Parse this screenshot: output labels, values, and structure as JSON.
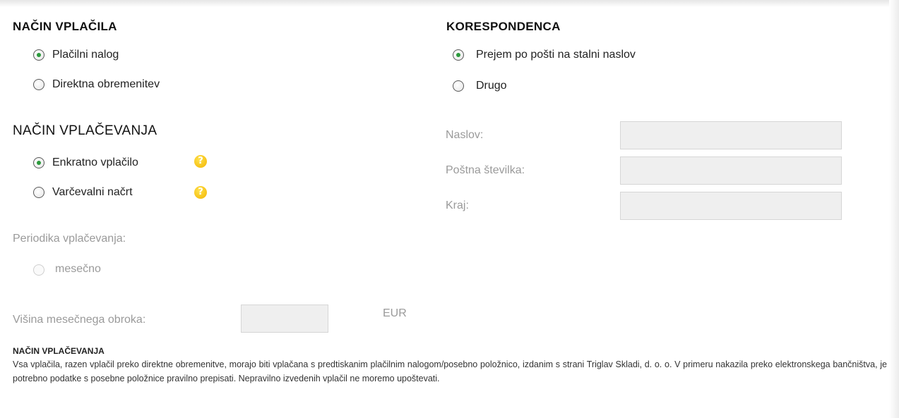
{
  "payment_method": {
    "heading": "NAČIN VPLAČILA",
    "options": [
      {
        "label": "Plačilni nalog",
        "selected": true
      },
      {
        "label": "Direktna obremenitev",
        "selected": false
      }
    ]
  },
  "correspondence": {
    "heading": "KORESPONDENCA",
    "options": [
      {
        "label": "Prejem po pošti na stalni naslov",
        "selected": true
      },
      {
        "label": "Drugo",
        "selected": false
      }
    ],
    "fields": {
      "address_label": "Naslov:",
      "postal_label": "Poštna številka:",
      "city_label": "Kraj:"
    }
  },
  "payment_mode": {
    "heading": "NAČIN VPLAČEVANJA",
    "options": [
      {
        "label": "Enkratno vplačilo",
        "selected": true
      },
      {
        "label": "Varčevalni načrt",
        "selected": false
      }
    ],
    "help_glyph": "?",
    "periodicity_label": "Periodika vplačevanja:",
    "periodicity_option": "mesečno",
    "installment_label": "Višina mesečnega obroka:",
    "currency": "EUR"
  },
  "note": {
    "heading": "NAČIN VPLAČEVANJA",
    "text": "Vsa vplačila, razen vplačil preko direktne obremenitve, morajo biti vplačana s predtiskanim plačilnim nalogom/posebno položnico, izdanim s strani Triglav Skladi, d. o. o. V primeru nakazila preko elektronskega bančništva, je potrebno podatke s posebne položnice pravilno prepisati. Nepravilno izvedenih vplačil ne moremo upoštevati."
  },
  "colors": {
    "radio_selected": "#2c9a3c",
    "help_icon": "#f2b400",
    "field_bg": "#efefef",
    "disabled_text": "#9a9a9a"
  }
}
